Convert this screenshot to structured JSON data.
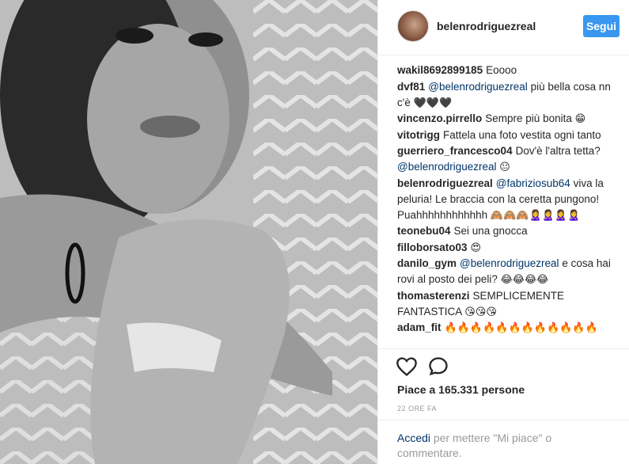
{
  "post": {
    "username": "belenrodriguezreal",
    "follow_label": "Segui",
    "likes_text": "Piace a 165.331 persone",
    "timestamp": "22 ORE FA"
  },
  "comments": [
    {
      "user": "wakil8692899185",
      "text": "Eoooo"
    },
    {
      "user": "dvf81",
      "mention": "@belenrodriguezreal",
      "text": "più bella cosa nn c'è",
      "emoji": "🖤🖤🖤"
    },
    {
      "user": "vincenzo.pirrello",
      "text": "Sempre più bonita",
      "emoji": "😁"
    },
    {
      "user": "vitotrigg",
      "text": "Fattela una foto vestita ogni tanto"
    },
    {
      "user": "guerriero_francesco04",
      "text": "Dov'è l'altra tetta?",
      "mention_after": "@belenrodriguezreal",
      "emoji": "😐"
    },
    {
      "user": "belenrodriguezreal",
      "mention": "@fabriziosub64",
      "text": "viva la peluria! Le braccia con la ceretta pungono! Puahhhhhhhhhhhh",
      "emoji": "🙈🙈🙈🙎‍♀️🙎‍♀️🙎‍♀️🙎‍♀️"
    },
    {
      "user": "teonebu04",
      "text": "Sei una gnocca"
    },
    {
      "user": "filloborsato03",
      "text": "",
      "emoji": "😍"
    },
    {
      "user": "danilo_gym",
      "mention": "@belenrodriguezreal",
      "text": "e cosa hai rovi al posto dei peli?",
      "emoji": "😂😂😂😂"
    },
    {
      "user": "thomasterenzi",
      "text": "SEMPLICEMENTE FANTASTICA",
      "emoji": "😘😘😘"
    },
    {
      "user": "adam_fit",
      "text": "",
      "emoji": "🔥🔥🔥🔥🔥🔥🔥🔥🔥🔥🔥🔥"
    }
  ],
  "login": {
    "link": "Accedi",
    "text": " per mettere \"Mi piace\" o commentare."
  },
  "colors": {
    "accent": "#3897f0",
    "mention": "#003569",
    "text": "#262626",
    "muted": "#999999"
  },
  "icons": [
    "heart-icon",
    "comment-bubble-icon"
  ]
}
